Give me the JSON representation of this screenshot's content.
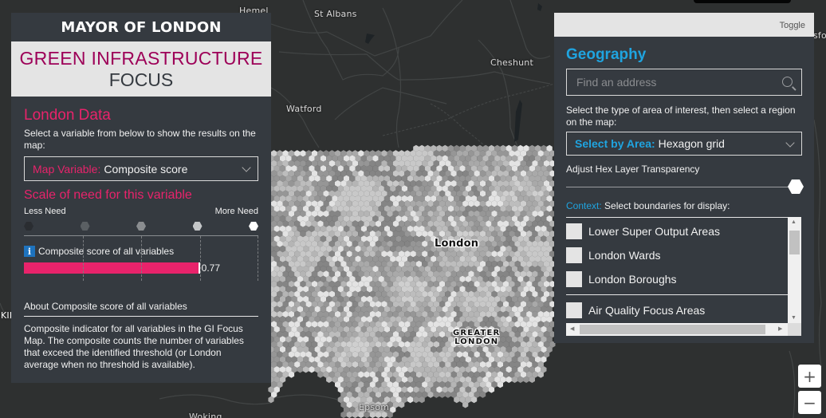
{
  "map": {
    "place_labels": [
      {
        "id": "hemel",
        "text": "Hemel"
      },
      {
        "id": "st-albans",
        "text": "St Albans"
      },
      {
        "id": "cheshunt",
        "text": "Cheshunt"
      },
      {
        "id": "watford",
        "text": "Watford"
      },
      {
        "id": "epsom",
        "text": "Epsom"
      },
      {
        "id": "woking",
        "text": "Woking"
      },
      {
        "id": "london",
        "text": "London"
      },
      {
        "id": "greater-london-1",
        "text": "GREATER"
      },
      {
        "id": "greater-london-2",
        "text": "LONDON"
      },
      {
        "id": "edge-left",
        "text": "KII"
      },
      {
        "id": "edge-right",
        "text": "sfor"
      }
    ],
    "hex_layer_colors": [
      "#cfcfcf",
      "#bdbdbd",
      "#a9a9a9",
      "#969696",
      "#e3e3e3",
      "#858585",
      "#b5b5b5",
      "#c8c8c8"
    ]
  },
  "left_panel": {
    "org_name": "MAYOR OF LONDON",
    "title_line1": "GREEN INFRASTRUCTURE",
    "title_line2": "FOCUS",
    "section_title": "London Data",
    "instructions": "Select a variable from below to show the results on the map:",
    "map_variable": {
      "label": "Map Variable:",
      "value": "Composite score"
    },
    "scale_title": "Scale of need for this variable",
    "scale_less": "Less Need",
    "scale_more": "More Need",
    "scale_levels": [
      "#2a2d31",
      "#5a5f63",
      "#8a8d90",
      "#c4c6c8",
      "#ffffff"
    ],
    "indicator_label": "Composite score of all variables",
    "indicator_value": "0.77",
    "indicator_fraction": 0.77,
    "about_title": "About Composite score of all variables",
    "about_text": "Composite indicator for all variables in the GI Focus Map. The composite counts the number of variables that exceed the identified threshold (or London average when no threshold is available).",
    "colors": {
      "accent_pink": "#e8236b",
      "title_magenta": "#9d0058",
      "panel_bg": "#353a40"
    }
  },
  "right_panel": {
    "toggle_label": "Toggle",
    "section_title": "Geography",
    "search_placeholder": "Find an address",
    "instructions": "Select the type of area of interest, then select a region on the map:",
    "select_by_area": {
      "label": "Select by Area:",
      "value": "Hexagon grid"
    },
    "transparency_label": "Adjust Hex Layer Transparency",
    "transparency_value": 1.0,
    "context_key": "Context:",
    "context_text": "Select boundaries for display:",
    "boundaries": [
      {
        "label": "Lower Super Output Areas",
        "checked": false
      },
      {
        "label": "London Wards",
        "checked": false
      },
      {
        "label": "London Boroughs",
        "checked": false
      },
      {
        "label": "Air Quality Focus Areas",
        "checked": false
      }
    ],
    "colors": {
      "accent_blue": "#1fa4e0"
    }
  },
  "zoom_controls": {
    "zoom_in": "+",
    "zoom_out": "−"
  }
}
